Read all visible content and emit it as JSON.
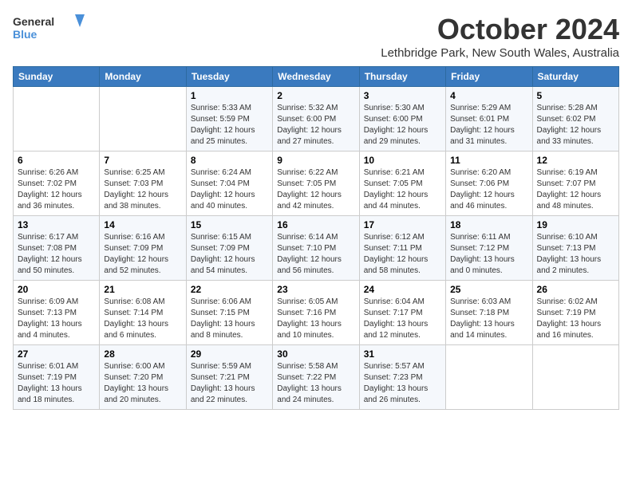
{
  "logo": {
    "line1": "General",
    "line2": "Blue"
  },
  "title": "October 2024",
  "location": "Lethbridge Park, New South Wales, Australia",
  "days_of_week": [
    "Sunday",
    "Monday",
    "Tuesday",
    "Wednesday",
    "Thursday",
    "Friday",
    "Saturday"
  ],
  "weeks": [
    [
      {
        "day": "",
        "sunrise": "",
        "sunset": "",
        "daylight": ""
      },
      {
        "day": "",
        "sunrise": "",
        "sunset": "",
        "daylight": ""
      },
      {
        "day": "1",
        "sunrise": "Sunrise: 5:33 AM",
        "sunset": "Sunset: 5:59 PM",
        "daylight": "Daylight: 12 hours and 25 minutes."
      },
      {
        "day": "2",
        "sunrise": "Sunrise: 5:32 AM",
        "sunset": "Sunset: 6:00 PM",
        "daylight": "Daylight: 12 hours and 27 minutes."
      },
      {
        "day": "3",
        "sunrise": "Sunrise: 5:30 AM",
        "sunset": "Sunset: 6:00 PM",
        "daylight": "Daylight: 12 hours and 29 minutes."
      },
      {
        "day": "4",
        "sunrise": "Sunrise: 5:29 AM",
        "sunset": "Sunset: 6:01 PM",
        "daylight": "Daylight: 12 hours and 31 minutes."
      },
      {
        "day": "5",
        "sunrise": "Sunrise: 5:28 AM",
        "sunset": "Sunset: 6:02 PM",
        "daylight": "Daylight: 12 hours and 33 minutes."
      }
    ],
    [
      {
        "day": "6",
        "sunrise": "Sunrise: 6:26 AM",
        "sunset": "Sunset: 7:02 PM",
        "daylight": "Daylight: 12 hours and 36 minutes."
      },
      {
        "day": "7",
        "sunrise": "Sunrise: 6:25 AM",
        "sunset": "Sunset: 7:03 PM",
        "daylight": "Daylight: 12 hours and 38 minutes."
      },
      {
        "day": "8",
        "sunrise": "Sunrise: 6:24 AM",
        "sunset": "Sunset: 7:04 PM",
        "daylight": "Daylight: 12 hours and 40 minutes."
      },
      {
        "day": "9",
        "sunrise": "Sunrise: 6:22 AM",
        "sunset": "Sunset: 7:05 PM",
        "daylight": "Daylight: 12 hours and 42 minutes."
      },
      {
        "day": "10",
        "sunrise": "Sunrise: 6:21 AM",
        "sunset": "Sunset: 7:05 PM",
        "daylight": "Daylight: 12 hours and 44 minutes."
      },
      {
        "day": "11",
        "sunrise": "Sunrise: 6:20 AM",
        "sunset": "Sunset: 7:06 PM",
        "daylight": "Daylight: 12 hours and 46 minutes."
      },
      {
        "day": "12",
        "sunrise": "Sunrise: 6:19 AM",
        "sunset": "Sunset: 7:07 PM",
        "daylight": "Daylight: 12 hours and 48 minutes."
      }
    ],
    [
      {
        "day": "13",
        "sunrise": "Sunrise: 6:17 AM",
        "sunset": "Sunset: 7:08 PM",
        "daylight": "Daylight: 12 hours and 50 minutes."
      },
      {
        "day": "14",
        "sunrise": "Sunrise: 6:16 AM",
        "sunset": "Sunset: 7:09 PM",
        "daylight": "Daylight: 12 hours and 52 minutes."
      },
      {
        "day": "15",
        "sunrise": "Sunrise: 6:15 AM",
        "sunset": "Sunset: 7:09 PM",
        "daylight": "Daylight: 12 hours and 54 minutes."
      },
      {
        "day": "16",
        "sunrise": "Sunrise: 6:14 AM",
        "sunset": "Sunset: 7:10 PM",
        "daylight": "Daylight: 12 hours and 56 minutes."
      },
      {
        "day": "17",
        "sunrise": "Sunrise: 6:12 AM",
        "sunset": "Sunset: 7:11 PM",
        "daylight": "Daylight: 12 hours and 58 minutes."
      },
      {
        "day": "18",
        "sunrise": "Sunrise: 6:11 AM",
        "sunset": "Sunset: 7:12 PM",
        "daylight": "Daylight: 13 hours and 0 minutes."
      },
      {
        "day": "19",
        "sunrise": "Sunrise: 6:10 AM",
        "sunset": "Sunset: 7:13 PM",
        "daylight": "Daylight: 13 hours and 2 minutes."
      }
    ],
    [
      {
        "day": "20",
        "sunrise": "Sunrise: 6:09 AM",
        "sunset": "Sunset: 7:13 PM",
        "daylight": "Daylight: 13 hours and 4 minutes."
      },
      {
        "day": "21",
        "sunrise": "Sunrise: 6:08 AM",
        "sunset": "Sunset: 7:14 PM",
        "daylight": "Daylight: 13 hours and 6 minutes."
      },
      {
        "day": "22",
        "sunrise": "Sunrise: 6:06 AM",
        "sunset": "Sunset: 7:15 PM",
        "daylight": "Daylight: 13 hours and 8 minutes."
      },
      {
        "day": "23",
        "sunrise": "Sunrise: 6:05 AM",
        "sunset": "Sunset: 7:16 PM",
        "daylight": "Daylight: 13 hours and 10 minutes."
      },
      {
        "day": "24",
        "sunrise": "Sunrise: 6:04 AM",
        "sunset": "Sunset: 7:17 PM",
        "daylight": "Daylight: 13 hours and 12 minutes."
      },
      {
        "day": "25",
        "sunrise": "Sunrise: 6:03 AM",
        "sunset": "Sunset: 7:18 PM",
        "daylight": "Daylight: 13 hours and 14 minutes."
      },
      {
        "day": "26",
        "sunrise": "Sunrise: 6:02 AM",
        "sunset": "Sunset: 7:19 PM",
        "daylight": "Daylight: 13 hours and 16 minutes."
      }
    ],
    [
      {
        "day": "27",
        "sunrise": "Sunrise: 6:01 AM",
        "sunset": "Sunset: 7:19 PM",
        "daylight": "Daylight: 13 hours and 18 minutes."
      },
      {
        "day": "28",
        "sunrise": "Sunrise: 6:00 AM",
        "sunset": "Sunset: 7:20 PM",
        "daylight": "Daylight: 13 hours and 20 minutes."
      },
      {
        "day": "29",
        "sunrise": "Sunrise: 5:59 AM",
        "sunset": "Sunset: 7:21 PM",
        "daylight": "Daylight: 13 hours and 22 minutes."
      },
      {
        "day": "30",
        "sunrise": "Sunrise: 5:58 AM",
        "sunset": "Sunset: 7:22 PM",
        "daylight": "Daylight: 13 hours and 24 minutes."
      },
      {
        "day": "31",
        "sunrise": "Sunrise: 5:57 AM",
        "sunset": "Sunset: 7:23 PM",
        "daylight": "Daylight: 13 hours and 26 minutes."
      },
      {
        "day": "",
        "sunrise": "",
        "sunset": "",
        "daylight": ""
      },
      {
        "day": "",
        "sunrise": "",
        "sunset": "",
        "daylight": ""
      }
    ]
  ]
}
